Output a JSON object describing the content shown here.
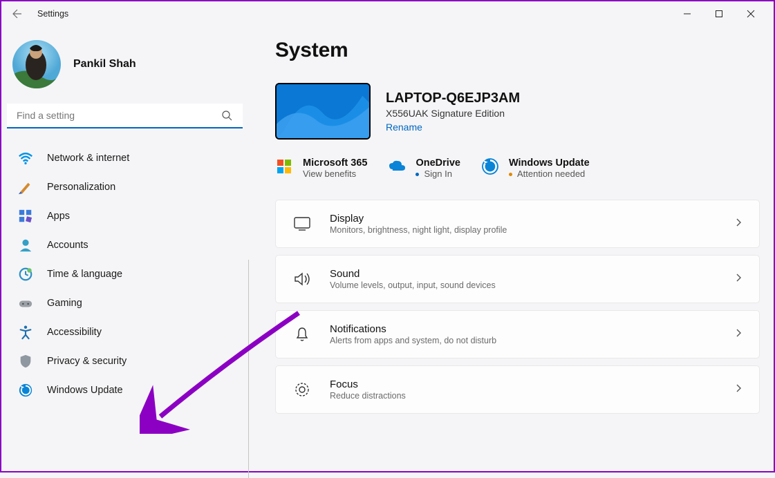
{
  "window": {
    "title": "Settings"
  },
  "user": {
    "name": "Pankil Shah"
  },
  "search": {
    "placeholder": "Find a setting"
  },
  "nav": {
    "items": [
      {
        "label": "Network & internet",
        "icon": "wifi"
      },
      {
        "label": "Personalization",
        "icon": "brush"
      },
      {
        "label": "Apps",
        "icon": "apps"
      },
      {
        "label": "Accounts",
        "icon": "person"
      },
      {
        "label": "Time & language",
        "icon": "clock"
      },
      {
        "label": "Gaming",
        "icon": "gamepad"
      },
      {
        "label": "Accessibility",
        "icon": "accessibility"
      },
      {
        "label": "Privacy & security",
        "icon": "shield"
      },
      {
        "label": "Windows Update",
        "icon": "update"
      }
    ]
  },
  "page": {
    "title": "System"
  },
  "device": {
    "name": "LAPTOP-Q6EJP3AM",
    "model": "X556UAK Signature Edition",
    "rename": "Rename"
  },
  "promos": [
    {
      "title": "Microsoft 365",
      "sub": "View benefits",
      "icon": "ms365",
      "bullet": ""
    },
    {
      "title": "OneDrive",
      "sub": "Sign In",
      "icon": "onedrive",
      "bullet": "blue"
    },
    {
      "title": "Windows Update",
      "sub": "Attention needed",
      "icon": "update-blue",
      "bullet": "orange"
    }
  ],
  "cards": [
    {
      "title": "Display",
      "sub": "Monitors, brightness, night light, display profile",
      "icon": "display"
    },
    {
      "title": "Sound",
      "sub": "Volume levels, output, input, sound devices",
      "icon": "sound"
    },
    {
      "title": "Notifications",
      "sub": "Alerts from apps and system, do not disturb",
      "icon": "bell"
    },
    {
      "title": "Focus",
      "sub": "Reduce distractions",
      "icon": "focus"
    }
  ]
}
